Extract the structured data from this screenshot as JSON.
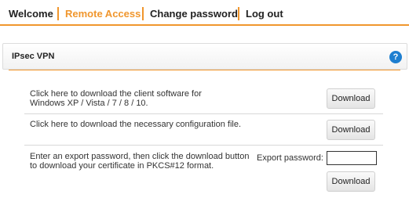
{
  "nav": {
    "items": [
      {
        "label": "Welcome",
        "color": "#222222"
      },
      {
        "label": "Remote Access",
        "color": "#f0962d"
      },
      {
        "label": "Change password",
        "color": "#222222"
      },
      {
        "label": "Log out",
        "color": "#222222"
      }
    ]
  },
  "panel": {
    "title": "IPsec VPN",
    "help_glyph": "?"
  },
  "rows": {
    "client": {
      "description": "Click here to download the client software for Windows XP / Vista / 7 / 8 / 10.",
      "button": "Download"
    },
    "config": {
      "description": "Click here to download the necessary configuration file.",
      "button": "Download"
    },
    "cert": {
      "description": "Enter an export password, then click the download button to download your certificate in PKCS#12 format.",
      "password_label": "Export password:",
      "password_value": "",
      "button": "Download"
    }
  },
  "colors": {
    "accent": "#f0962d",
    "help": "#1e7fd0"
  }
}
